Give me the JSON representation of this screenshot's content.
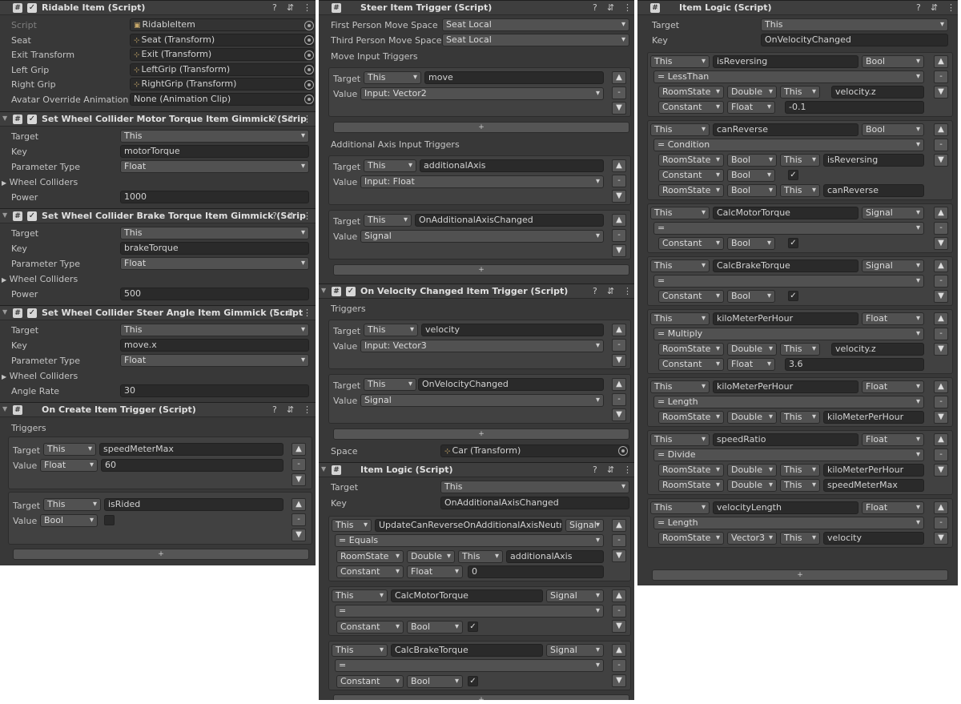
{
  "p1": {
    "ridable": {
      "title": "Ridable Item (Script)",
      "script_label": "Script",
      "script_value": "RidableItem",
      "rows": [
        {
          "label": "Seat",
          "value": "Seat (Transform)"
        },
        {
          "label": "Exit Transform",
          "value": "Exit (Transform)"
        },
        {
          "label": "Left Grip",
          "value": "LeftGrip (Transform)"
        },
        {
          "label": "Right Grip",
          "value": "RightGrip (Transform)"
        }
      ],
      "avatar_label": "Avatar Override Animation",
      "avatar_value": "None (Animation Clip)"
    },
    "motor": {
      "title": "Set Wheel Collider Motor Torque Item Gimmick (Scrip",
      "target_label": "Target",
      "target": "This",
      "key_label": "Key",
      "key": "motorTorque",
      "ptype_label": "Parameter Type",
      "ptype": "Float",
      "wc_label": "Wheel Colliders",
      "last_label": "Power",
      "last": "1000"
    },
    "brake": {
      "title": "Set Wheel Collider Brake Torque Item Gimmick (Scrip",
      "target_label": "Target",
      "target": "This",
      "key_label": "Key",
      "key": "brakeTorque",
      "ptype_label": "Parameter Type",
      "ptype": "Float",
      "wc_label": "Wheel Colliders",
      "last_label": "Power",
      "last": "500"
    },
    "steer": {
      "title": "Set Wheel Collider Steer Angle Item Gimmick (Script",
      "target_label": "Target",
      "target": "This",
      "key_label": "Key",
      "key": "move.x",
      "ptype_label": "Parameter Type",
      "ptype": "Float",
      "wc_label": "Wheel Colliders",
      "last_label": "Angle Rate",
      "last": "30"
    },
    "oncreate": {
      "title": "On Create Item Trigger (Script)",
      "triggers_label": "Triggers",
      "items": [
        {
          "target_label": "Target",
          "target": "This",
          "key": "speedMeterMax",
          "value_label": "Value",
          "type": "Float",
          "value": "60"
        },
        {
          "target_label": "Target",
          "target": "This",
          "key": "isRided",
          "value_label": "Value",
          "type": "Bool",
          "value": ""
        }
      ]
    }
  },
  "p2": {
    "steer": {
      "title": "Steer Item Trigger (Script)",
      "fp_label": "First Person Move Space",
      "fp": "Seat Local",
      "tp_label": "Third Person Move Space",
      "tp": "Seat Local",
      "mit_label": "Move Input Triggers",
      "move": {
        "target_label": "Target",
        "target": "This",
        "key": "move",
        "value_label": "Value",
        "value": "Input: Vector2"
      },
      "aait_label": "Additional Axis Input Triggers",
      "aa": [
        {
          "target_label": "Target",
          "target": "This",
          "key": "additionalAxis",
          "value_label": "Value",
          "value": "Input: Float"
        },
        {
          "target_label": "Target",
          "target": "This",
          "key": "OnAdditionalAxisChanged",
          "value_label": "Value",
          "value": "Signal"
        }
      ]
    },
    "vel": {
      "title": "On Velocity Changed Item Trigger (Script)",
      "triggers_label": "Triggers",
      "items": [
        {
          "target_label": "Target",
          "target": "This",
          "key": "velocity",
          "value_label": "Value",
          "value": "Input: Vector3"
        },
        {
          "target_label": "Target",
          "target": "This",
          "key": "OnVelocityChanged",
          "value_label": "Value",
          "value": "Signal"
        }
      ],
      "space_label": "Space",
      "space": "Car (Transform)"
    },
    "logic": {
      "title": "Item Logic (Script)",
      "target_label": "Target",
      "target": "This",
      "key_label": "Key",
      "key": "OnAdditionalAxisChanged",
      "e1": {
        "a": "This",
        "b": "UpdateCanReverseOnAdditionalAxisNeutra",
        "c": "Signal",
        "op": "= Equals",
        "r1": [
          "RoomState",
          "Double",
          "This",
          "additionalAxis"
        ],
        "r2": [
          "Constant",
          "Float",
          "0"
        ]
      },
      "e2": {
        "a": "This",
        "b": "CalcMotorTorque",
        "c": "Signal",
        "op": "=",
        "r1": [
          "Constant",
          "Bool"
        ]
      },
      "e3": {
        "a": "This",
        "b": "CalcBrakeTorque",
        "c": "Signal",
        "op": "=",
        "r1": [
          "Constant",
          "Bool"
        ]
      }
    }
  },
  "p3": {
    "logic": {
      "title": "Item Logic (Script)",
      "target_label": "Target",
      "target": "This",
      "key_label": "Key",
      "key": "OnVelocityChanged"
    },
    "blocks": [
      {
        "a": "This",
        "b": "isReversing",
        "c": "Bool",
        "op": "= LessThan",
        "rows": [
          [
            "RoomState",
            "Double",
            "This",
            "velocity.z"
          ],
          [
            "Constant",
            "Float",
            "-0.1"
          ]
        ]
      },
      {
        "a": "This",
        "b": "canReverse",
        "c": "Bool",
        "op": "= Condition",
        "rows": [
          [
            "RoomState",
            "Bool",
            "This",
            "isReversing"
          ],
          [
            "Constant",
            "Bool",
            "✓"
          ],
          [
            "RoomState",
            "Bool",
            "This",
            "canReverse"
          ]
        ]
      },
      {
        "a": "This",
        "b": "CalcMotorTorque",
        "c": "Signal",
        "op": "=",
        "rows": [
          [
            "Constant",
            "Bool",
            "✓"
          ]
        ]
      },
      {
        "a": "This",
        "b": "CalcBrakeTorque",
        "c": "Signal",
        "op": "=",
        "rows": [
          [
            "Constant",
            "Bool",
            "✓"
          ]
        ]
      },
      {
        "a": "This",
        "b": "kiloMeterPerHour",
        "c": "Float",
        "op": "= Multiply",
        "rows": [
          [
            "RoomState",
            "Double",
            "This",
            "velocity.z"
          ],
          [
            "Constant",
            "Float",
            "3.6"
          ]
        ]
      },
      {
        "a": "This",
        "b": "kiloMeterPerHour",
        "c": "Float",
        "op": "= Length",
        "rows": [
          [
            "RoomState",
            "Double",
            "This",
            "kiloMeterPerHour"
          ]
        ]
      },
      {
        "a": "This",
        "b": "speedRatio",
        "c": "Float",
        "op": "= Divide",
        "rows": [
          [
            "RoomState",
            "Double",
            "This",
            "kiloMeterPerHour"
          ],
          [
            "RoomState",
            "Double",
            "This",
            "speedMeterMax"
          ]
        ]
      },
      {
        "a": "This",
        "b": "velocityLength",
        "c": "Float",
        "op": "= Length",
        "rows": [
          [
            "RoomState",
            "Vector3",
            "This",
            "velocity"
          ]
        ]
      }
    ]
  },
  "icons": {
    "help": "help-icon",
    "preset": "preset-icon",
    "menu": "kebab-menu-icon",
    "plus": "+",
    "minus": "-",
    "up": "▲",
    "down": "▼",
    "check": "✓",
    "script": "#"
  }
}
